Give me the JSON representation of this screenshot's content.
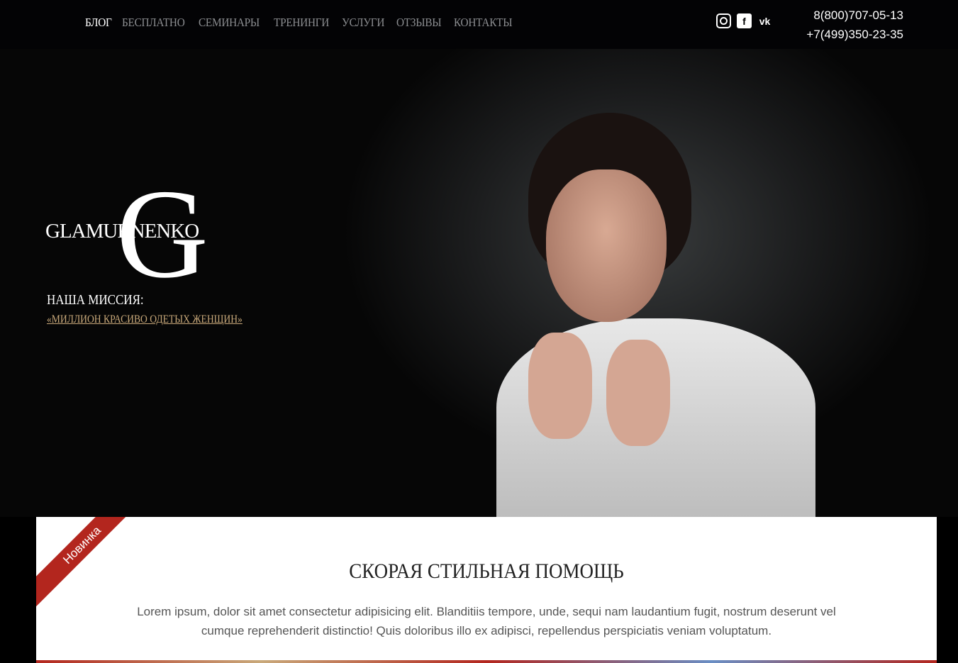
{
  "nav": {
    "items": [
      "БЛОГ",
      "БЕСПЛАТНО",
      "СЕМИНАРЫ",
      "ТРЕНИНГИ",
      "УСЛУГИ",
      "ОТЗЫВЫ",
      "КОНТАКТЫ"
    ]
  },
  "social": [
    "instagram-icon",
    "facebook-icon",
    "vk-icon"
  ],
  "phones": [
    "8(800)707-05-13",
    "+7(499)350-23-35"
  ],
  "logo": {
    "letter": "G",
    "word": "GLAMURNENKO"
  },
  "mission": {
    "title": "НАША МИССИЯ:",
    "link": "«МИЛЛИОН КРАСИВО ОДЕТЫХ ЖЕНЩИН»"
  },
  "card": {
    "badge": "Новинка",
    "title": "СКОРАЯ СТИЛЬНАЯ ПОМОЩЬ",
    "text": "Lorem ipsum, dolor sit amet consectetur adipisicing elit. Blanditiis tempore, unde, sequi nam laudantium fugit, nostrum deserunt vel cumque reprehenderit distinctio! Quis doloribus illo ex adipisci, repellendus perspiciatis veniam voluptatum."
  },
  "colors": {
    "accent": "#b3261e",
    "gold": "#c9a97a"
  }
}
